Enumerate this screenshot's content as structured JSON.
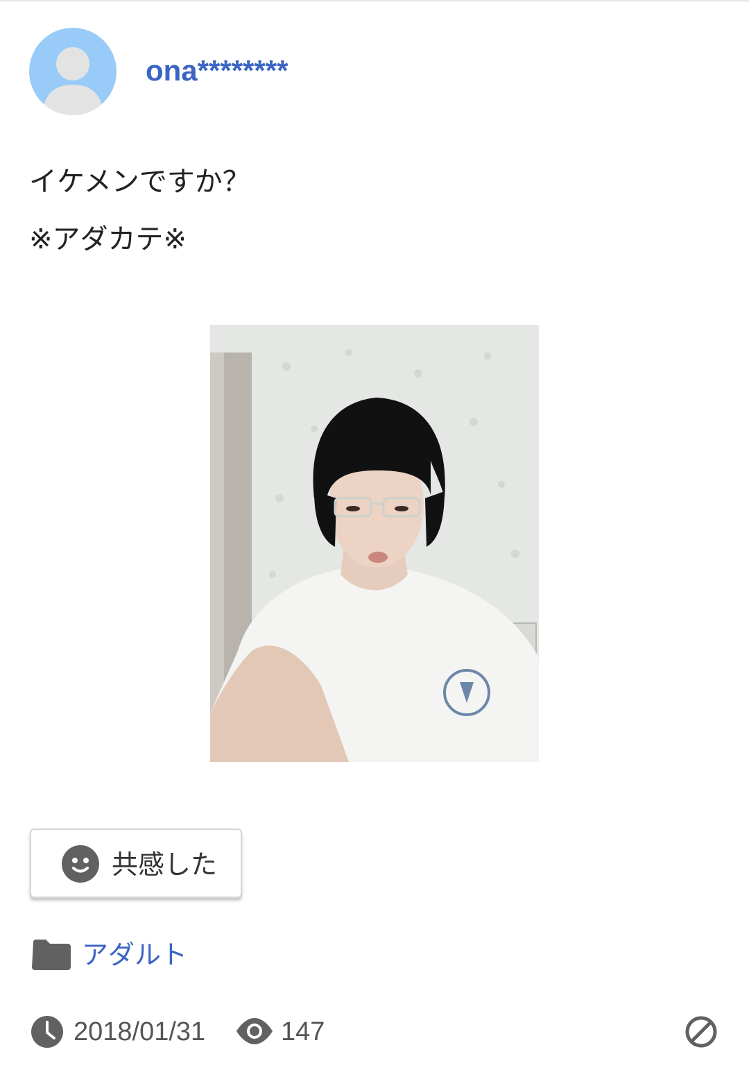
{
  "post": {
    "username": "ona********",
    "body_lines": [
      "イケメンですか？",
      "※アダカテ※"
    ],
    "photo_icon": "selfie-photo",
    "empathy_label": "共感した",
    "category": "アダルト",
    "date": "2018/01/31",
    "views": "147"
  },
  "icons": {
    "avatar": "default-user-avatar",
    "empathy": "smiley-face-icon",
    "category": "folder-icon",
    "date": "clock-icon",
    "views": "eye-icon",
    "report": "block-icon"
  },
  "colors": {
    "link": "#3b64c4",
    "icon_gray": "#616161",
    "avatar_bg": "#e3e3e3",
    "avatar_fg": "#99cbf8"
  }
}
